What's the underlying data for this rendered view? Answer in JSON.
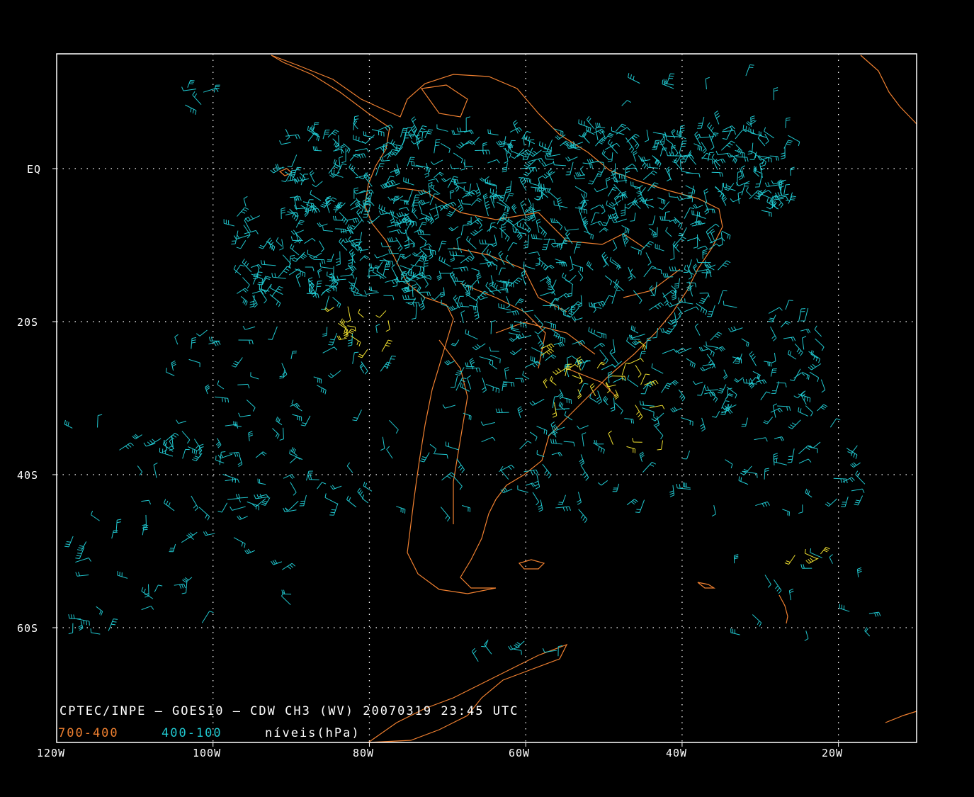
{
  "map": {
    "caption": "CPTEC/INPE — GOES10 — CDW CH3 (WV) 20070319 23:45 UTC",
    "legend": {
      "low_levels": "700-400",
      "high_levels": "400-100",
      "units": "níveis(hPa)"
    },
    "lon_labels": [
      "120W",
      "100W",
      "80W",
      "60W",
      "40W",
      "20W"
    ],
    "lat_labels": [
      "EQ",
      "20S",
      "40S",
      "60S"
    ],
    "extent": {
      "lon_min": -120,
      "lon_max": -10,
      "lat_max": 15,
      "lat_min": -75
    },
    "grid": "dotted",
    "colors": {
      "background": "#000000",
      "frame": "#ffffff",
      "coastline": "#f08030",
      "barb_high": "#20c8d0",
      "barb_low": "#f0e030",
      "grid": "#ffffff"
    }
  }
}
